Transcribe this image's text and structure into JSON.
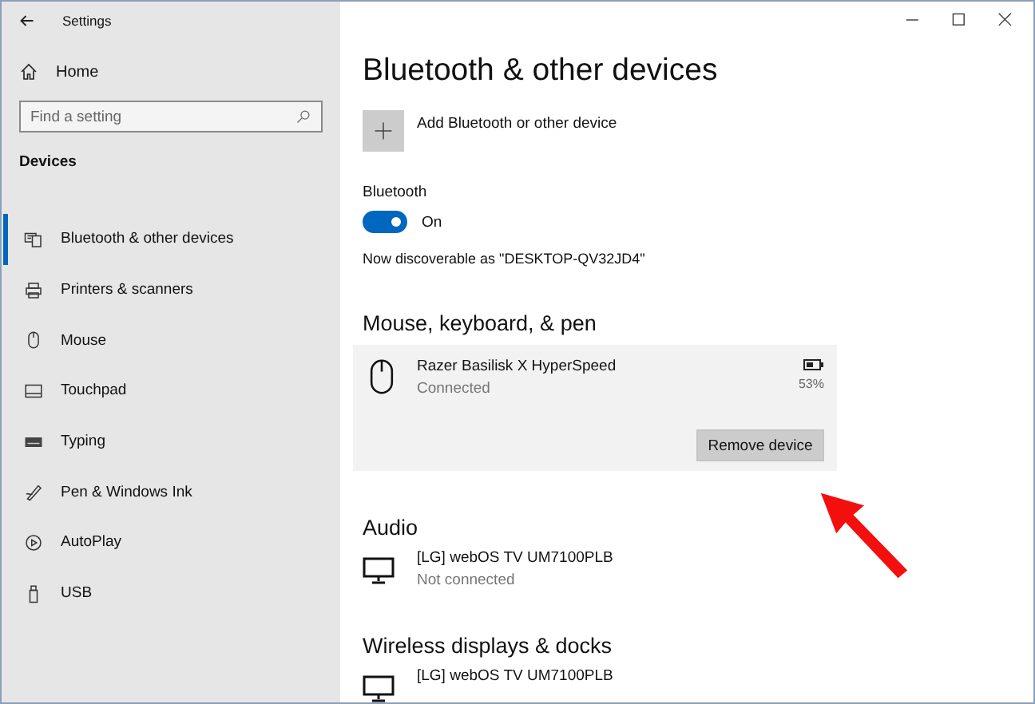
{
  "window": {
    "title": "Settings"
  },
  "sidebar": {
    "home": "Home",
    "search": {
      "placeholder": "Find a setting"
    },
    "section": "Devices",
    "items": [
      {
        "label": "Bluetooth & other devices",
        "kind": "bluetooth",
        "selected": true
      },
      {
        "label": "Printers & scanners",
        "kind": "printer",
        "selected": false
      },
      {
        "label": "Mouse",
        "kind": "mouse",
        "selected": false
      },
      {
        "label": "Touchpad",
        "kind": "touchpad",
        "selected": false
      },
      {
        "label": "Typing",
        "kind": "keyboard",
        "selected": false
      },
      {
        "label": "Pen & Windows Ink",
        "kind": "pen",
        "selected": false
      },
      {
        "label": "AutoPlay",
        "kind": "autoplay",
        "selected": false
      },
      {
        "label": "USB",
        "kind": "usb",
        "selected": false
      }
    ]
  },
  "page": {
    "title": "Bluetooth & other devices",
    "add_button": "Add Bluetooth or other device",
    "bluetooth": {
      "label": "Bluetooth",
      "on": true,
      "state": "On"
    },
    "discoverable": "Now discoverable as \"DESKTOP-QV32JD4\"",
    "sections": [
      {
        "heading": "Mouse, keyboard, & pen",
        "devices": [
          {
            "name": "Razer Basilisk X HyperSpeed",
            "status": "Connected",
            "kind": "mouse",
            "expanded": true,
            "battery": "53%",
            "remove_button": "Remove device"
          }
        ]
      },
      {
        "heading": "Audio",
        "devices": [
          {
            "name": "[LG] webOS TV UM7100PLB",
            "status": "Not connected",
            "kind": "monitor",
            "expanded": false
          }
        ]
      },
      {
        "heading": "Wireless displays & docks",
        "devices": [
          {
            "name": "[LG] webOS TV UM7100PLB",
            "kind": "monitor",
            "expanded": false
          }
        ]
      }
    ]
  }
}
